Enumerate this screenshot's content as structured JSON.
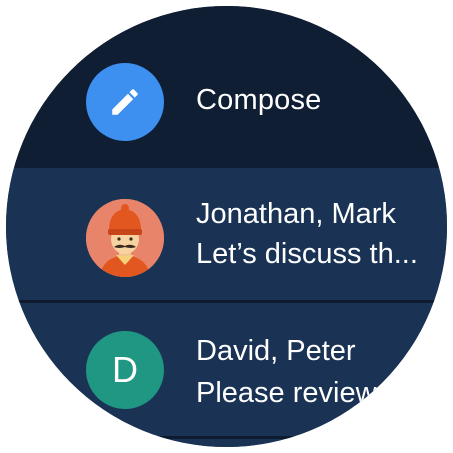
{
  "compose": {
    "label": "Compose",
    "icon": "pencil-icon",
    "color": "#3d8ff0"
  },
  "messages": [
    {
      "senders": "Jonathan, Mark",
      "preview": "Let’s discuss th...",
      "avatar": "person-with-mustache-avatar",
      "avatar_color": "#e8846a"
    },
    {
      "senders": "David, Peter",
      "preview": "Please review",
      "avatar_letter": "D",
      "avatar_color": "#1f9783"
    }
  ],
  "colors": {
    "background": "#152b4a",
    "compose_background": "#0f1e33",
    "row_background": "#1a3355",
    "text": "#ffffff"
  }
}
